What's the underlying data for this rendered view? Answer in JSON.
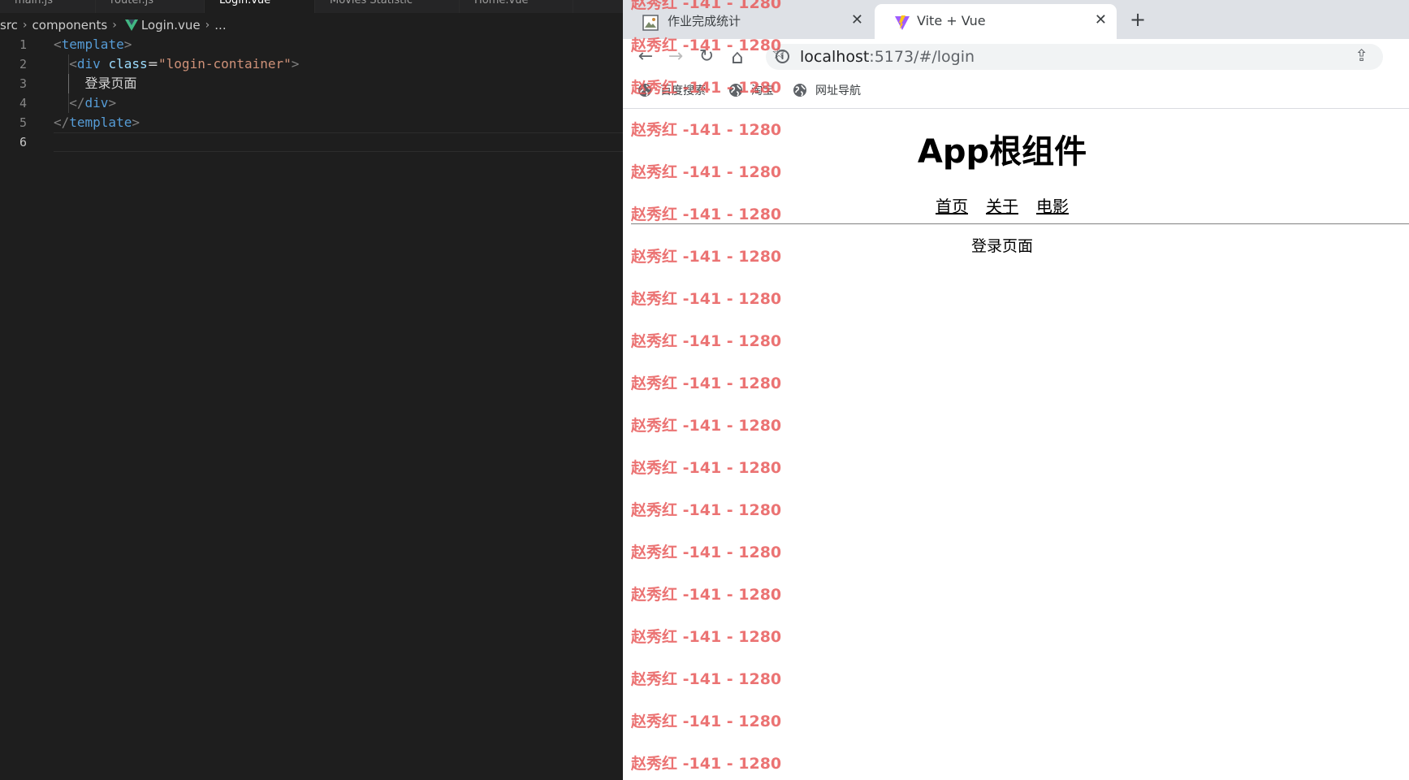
{
  "editor": {
    "tabs": [
      {
        "label": "main.js"
      },
      {
        "label": "router.js"
      },
      {
        "label": "Login.vue",
        "close": "×"
      },
      {
        "label": "Movies Statistic"
      },
      {
        "label": "Home.vue"
      }
    ],
    "breadcrumb": {
      "parts": [
        "src",
        "components",
        "Login.vue",
        "..."
      ],
      "separator": "›"
    },
    "lines": [
      {
        "number": "1",
        "tokens": [
          [
            "br",
            "<"
          ],
          [
            "tag",
            "template"
          ],
          [
            "br",
            ">"
          ]
        ]
      },
      {
        "number": "2",
        "tokens": [
          [
            "sp",
            "  "
          ],
          [
            "br",
            "<"
          ],
          [
            "tag",
            "div"
          ],
          [
            "sp",
            " "
          ],
          [
            "attr",
            "class"
          ],
          [
            "txt",
            "="
          ],
          [
            "str",
            "\"login-container\""
          ],
          [
            "br",
            ">"
          ]
        ]
      },
      {
        "number": "3",
        "tokens": [
          [
            "sp",
            "    "
          ],
          [
            "txt",
            "登录页面"
          ]
        ]
      },
      {
        "number": "4",
        "tokens": [
          [
            "sp",
            "  "
          ],
          [
            "br",
            "</"
          ],
          [
            "tag",
            "div"
          ],
          [
            "br",
            ">"
          ]
        ]
      },
      {
        "number": "5",
        "tokens": [
          [
            "br",
            "</"
          ],
          [
            "tag",
            "template"
          ],
          [
            "br",
            ">"
          ]
        ]
      },
      {
        "number": "6",
        "tokens": []
      }
    ]
  },
  "browser": {
    "tabs": [
      {
        "title": "作业完成统计",
        "close": "✕"
      },
      {
        "title": "Vite + Vue",
        "close": "✕"
      }
    ],
    "new_tab": "+",
    "nav": {
      "back": "←",
      "forward": "→",
      "reload": "↻",
      "home": "⌂"
    },
    "url": {
      "host": "localhost",
      "rest": ":5173/#/login"
    },
    "info_glyph": "i",
    "share_glyph": "⇪",
    "star_glyph": "☆",
    "bookmarks": [
      {
        "label": "百度搜索"
      },
      {
        "label": "淘宝"
      },
      {
        "label": "网址导航"
      }
    ]
  },
  "app": {
    "title": "App根组件",
    "nav": [
      {
        "label": "首页"
      },
      {
        "label": "关于"
      },
      {
        "label": "电影"
      }
    ],
    "page_text": "登录页面"
  },
  "watermark": {
    "text": "赵秀红 -141 - 1280",
    "repeat": 19
  },
  "colors": {
    "editor_bg": "#1e1e1e",
    "watermark": "#e85a5a",
    "vue_green": "#42b883",
    "vite_purple": "#9f5cff",
    "vite_yellow": "#ffc517"
  }
}
